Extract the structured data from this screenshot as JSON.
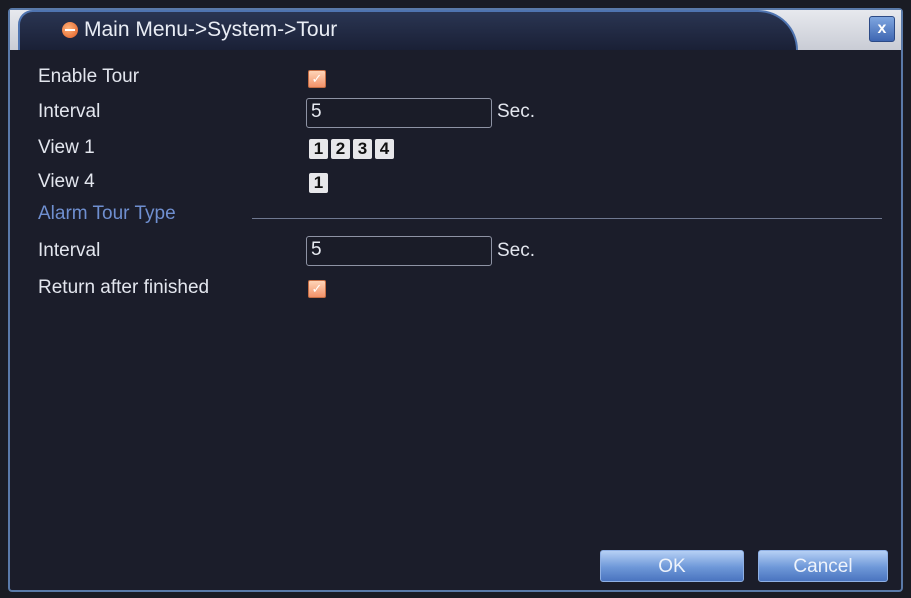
{
  "window": {
    "title": "Main Menu->System->Tour",
    "close_label": "x"
  },
  "tour": {
    "enable_label": "Enable Tour",
    "enable_checked": true,
    "interval_label": "Interval",
    "interval_value": "5",
    "interval_unit": "Sec.",
    "views": [
      {
        "label": "View 1",
        "channels": [
          "1",
          "2",
          "3",
          "4"
        ]
      },
      {
        "label": "View 4",
        "channels": [
          "1"
        ]
      }
    ]
  },
  "alarm_tour": {
    "section_label": "Alarm Tour Type",
    "interval_label": "Interval",
    "interval_value": "5",
    "interval_unit": "Sec.",
    "return_label": "Return after finished",
    "return_checked": true
  },
  "buttons": {
    "ok_label": "OK",
    "cancel_label": "Cancel"
  },
  "colors": {
    "accent": "#6f8fd0",
    "checkbox": "#f2926a",
    "button": "#6d97d8"
  }
}
